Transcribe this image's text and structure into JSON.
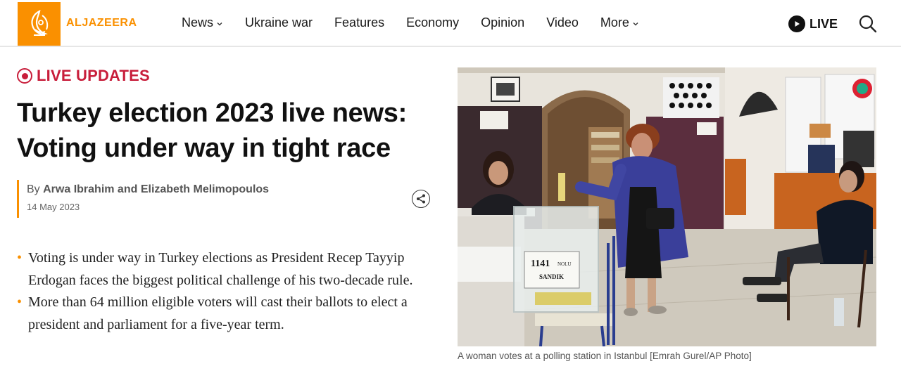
{
  "brand": {
    "name": "ALJAZEERA",
    "color": "#fa9000"
  },
  "nav": {
    "items": [
      {
        "label": "News",
        "dropdown": true
      },
      {
        "label": "Ukraine war",
        "dropdown": false
      },
      {
        "label": "Features",
        "dropdown": false
      },
      {
        "label": "Economy",
        "dropdown": false
      },
      {
        "label": "Opinion",
        "dropdown": false
      },
      {
        "label": "Video",
        "dropdown": false
      },
      {
        "label": "More",
        "dropdown": true
      }
    ],
    "live_label": "LIVE",
    "search_icon": "search-icon"
  },
  "article": {
    "badge": "LIVE UPDATES",
    "badge_color": "#c81e3b",
    "headline_line1": "Turkey election 2023 live news:",
    "headline_line2": "Voting under way in tight race",
    "byline_prefix": "By ",
    "authors": "Arwa Ibrahim and Elizabeth Melimopoulos",
    "date": "14 May 2023",
    "bullets": [
      "Voting is under way in Turkey elections as President Recep Tayyip Erdogan faces the biggest political challenge of his two-decade rule.",
      "More than 64 million eligible voters will cast their ballots to elect a president and parliament for a five-year term."
    ]
  },
  "image": {
    "caption": "A woman votes at a polling station in Istanbul [Emrah Gurel/AP Photo]",
    "ballot_box_label_line1": "1141",
    "ballot_box_label_small": "NOLU",
    "ballot_box_label_line2": "SANDIK"
  }
}
